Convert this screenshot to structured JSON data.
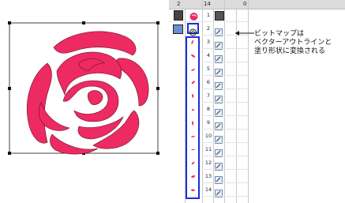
{
  "panel": {
    "header_numbers": [
      "2",
      "14",
      "0"
    ],
    "row_numbers": [
      "1",
      "2",
      "3",
      "4",
      "5",
      "6",
      "7",
      "8",
      "9",
      "10",
      "11",
      "12",
      "13",
      "14"
    ]
  },
  "annotation": {
    "line1": "ビットマップは",
    "line2": "ベクターアウトラインと",
    "line3": "塗り形状に変換される"
  },
  "colors": {
    "rose": "#ee2a62",
    "selection_border": "#1a2ee0",
    "panel_header": "#dcdcdc"
  },
  "icons": {
    "row1_left": "bitmap-layer-icon",
    "row2_left": "outline-layer-icon",
    "row_right": "fill-shape-icon"
  }
}
